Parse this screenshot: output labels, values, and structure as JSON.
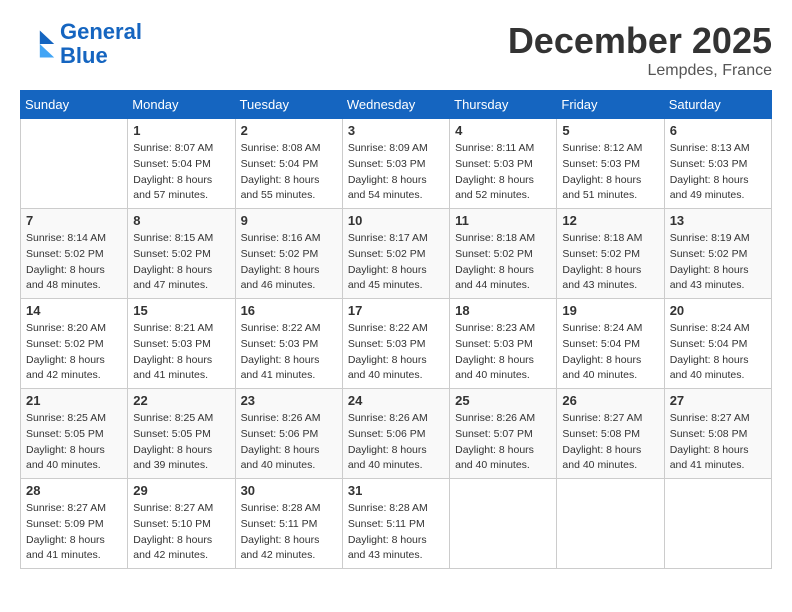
{
  "header": {
    "logo_line1": "General",
    "logo_line2": "Blue",
    "month": "December 2025",
    "location": "Lempdes, France"
  },
  "weekdays": [
    "Sunday",
    "Monday",
    "Tuesday",
    "Wednesday",
    "Thursday",
    "Friday",
    "Saturday"
  ],
  "weeks": [
    [
      {
        "day": "",
        "sunrise": "",
        "sunset": "",
        "daylight": ""
      },
      {
        "day": "1",
        "sunrise": "Sunrise: 8:07 AM",
        "sunset": "Sunset: 5:04 PM",
        "daylight": "Daylight: 8 hours and 57 minutes."
      },
      {
        "day": "2",
        "sunrise": "Sunrise: 8:08 AM",
        "sunset": "Sunset: 5:04 PM",
        "daylight": "Daylight: 8 hours and 55 minutes."
      },
      {
        "day": "3",
        "sunrise": "Sunrise: 8:09 AM",
        "sunset": "Sunset: 5:03 PM",
        "daylight": "Daylight: 8 hours and 54 minutes."
      },
      {
        "day": "4",
        "sunrise": "Sunrise: 8:11 AM",
        "sunset": "Sunset: 5:03 PM",
        "daylight": "Daylight: 8 hours and 52 minutes."
      },
      {
        "day": "5",
        "sunrise": "Sunrise: 8:12 AM",
        "sunset": "Sunset: 5:03 PM",
        "daylight": "Daylight: 8 hours and 51 minutes."
      },
      {
        "day": "6",
        "sunrise": "Sunrise: 8:13 AM",
        "sunset": "Sunset: 5:03 PM",
        "daylight": "Daylight: 8 hours and 49 minutes."
      }
    ],
    [
      {
        "day": "7",
        "sunrise": "Sunrise: 8:14 AM",
        "sunset": "Sunset: 5:02 PM",
        "daylight": "Daylight: 8 hours and 48 minutes."
      },
      {
        "day": "8",
        "sunrise": "Sunrise: 8:15 AM",
        "sunset": "Sunset: 5:02 PM",
        "daylight": "Daylight: 8 hours and 47 minutes."
      },
      {
        "day": "9",
        "sunrise": "Sunrise: 8:16 AM",
        "sunset": "Sunset: 5:02 PM",
        "daylight": "Daylight: 8 hours and 46 minutes."
      },
      {
        "day": "10",
        "sunrise": "Sunrise: 8:17 AM",
        "sunset": "Sunset: 5:02 PM",
        "daylight": "Daylight: 8 hours and 45 minutes."
      },
      {
        "day": "11",
        "sunrise": "Sunrise: 8:18 AM",
        "sunset": "Sunset: 5:02 PM",
        "daylight": "Daylight: 8 hours and 44 minutes."
      },
      {
        "day": "12",
        "sunrise": "Sunrise: 8:18 AM",
        "sunset": "Sunset: 5:02 PM",
        "daylight": "Daylight: 8 hours and 43 minutes."
      },
      {
        "day": "13",
        "sunrise": "Sunrise: 8:19 AM",
        "sunset": "Sunset: 5:02 PM",
        "daylight": "Daylight: 8 hours and 43 minutes."
      }
    ],
    [
      {
        "day": "14",
        "sunrise": "Sunrise: 8:20 AM",
        "sunset": "Sunset: 5:02 PM",
        "daylight": "Daylight: 8 hours and 42 minutes."
      },
      {
        "day": "15",
        "sunrise": "Sunrise: 8:21 AM",
        "sunset": "Sunset: 5:03 PM",
        "daylight": "Daylight: 8 hours and 41 minutes."
      },
      {
        "day": "16",
        "sunrise": "Sunrise: 8:22 AM",
        "sunset": "Sunset: 5:03 PM",
        "daylight": "Daylight: 8 hours and 41 minutes."
      },
      {
        "day": "17",
        "sunrise": "Sunrise: 8:22 AM",
        "sunset": "Sunset: 5:03 PM",
        "daylight": "Daylight: 8 hours and 40 minutes."
      },
      {
        "day": "18",
        "sunrise": "Sunrise: 8:23 AM",
        "sunset": "Sunset: 5:03 PM",
        "daylight": "Daylight: 8 hours and 40 minutes."
      },
      {
        "day": "19",
        "sunrise": "Sunrise: 8:24 AM",
        "sunset": "Sunset: 5:04 PM",
        "daylight": "Daylight: 8 hours and 40 minutes."
      },
      {
        "day": "20",
        "sunrise": "Sunrise: 8:24 AM",
        "sunset": "Sunset: 5:04 PM",
        "daylight": "Daylight: 8 hours and 40 minutes."
      }
    ],
    [
      {
        "day": "21",
        "sunrise": "Sunrise: 8:25 AM",
        "sunset": "Sunset: 5:05 PM",
        "daylight": "Daylight: 8 hours and 40 minutes."
      },
      {
        "day": "22",
        "sunrise": "Sunrise: 8:25 AM",
        "sunset": "Sunset: 5:05 PM",
        "daylight": "Daylight: 8 hours and 39 minutes."
      },
      {
        "day": "23",
        "sunrise": "Sunrise: 8:26 AM",
        "sunset": "Sunset: 5:06 PM",
        "daylight": "Daylight: 8 hours and 40 minutes."
      },
      {
        "day": "24",
        "sunrise": "Sunrise: 8:26 AM",
        "sunset": "Sunset: 5:06 PM",
        "daylight": "Daylight: 8 hours and 40 minutes."
      },
      {
        "day": "25",
        "sunrise": "Sunrise: 8:26 AM",
        "sunset": "Sunset: 5:07 PM",
        "daylight": "Daylight: 8 hours and 40 minutes."
      },
      {
        "day": "26",
        "sunrise": "Sunrise: 8:27 AM",
        "sunset": "Sunset: 5:08 PM",
        "daylight": "Daylight: 8 hours and 40 minutes."
      },
      {
        "day": "27",
        "sunrise": "Sunrise: 8:27 AM",
        "sunset": "Sunset: 5:08 PM",
        "daylight": "Daylight: 8 hours and 41 minutes."
      }
    ],
    [
      {
        "day": "28",
        "sunrise": "Sunrise: 8:27 AM",
        "sunset": "Sunset: 5:09 PM",
        "daylight": "Daylight: 8 hours and 41 minutes."
      },
      {
        "day": "29",
        "sunrise": "Sunrise: 8:27 AM",
        "sunset": "Sunset: 5:10 PM",
        "daylight": "Daylight: 8 hours and 42 minutes."
      },
      {
        "day": "30",
        "sunrise": "Sunrise: 8:28 AM",
        "sunset": "Sunset: 5:11 PM",
        "daylight": "Daylight: 8 hours and 42 minutes."
      },
      {
        "day": "31",
        "sunrise": "Sunrise: 8:28 AM",
        "sunset": "Sunset: 5:11 PM",
        "daylight": "Daylight: 8 hours and 43 minutes."
      },
      {
        "day": "",
        "sunrise": "",
        "sunset": "",
        "daylight": ""
      },
      {
        "day": "",
        "sunrise": "",
        "sunset": "",
        "daylight": ""
      },
      {
        "day": "",
        "sunrise": "",
        "sunset": "",
        "daylight": ""
      }
    ]
  ]
}
